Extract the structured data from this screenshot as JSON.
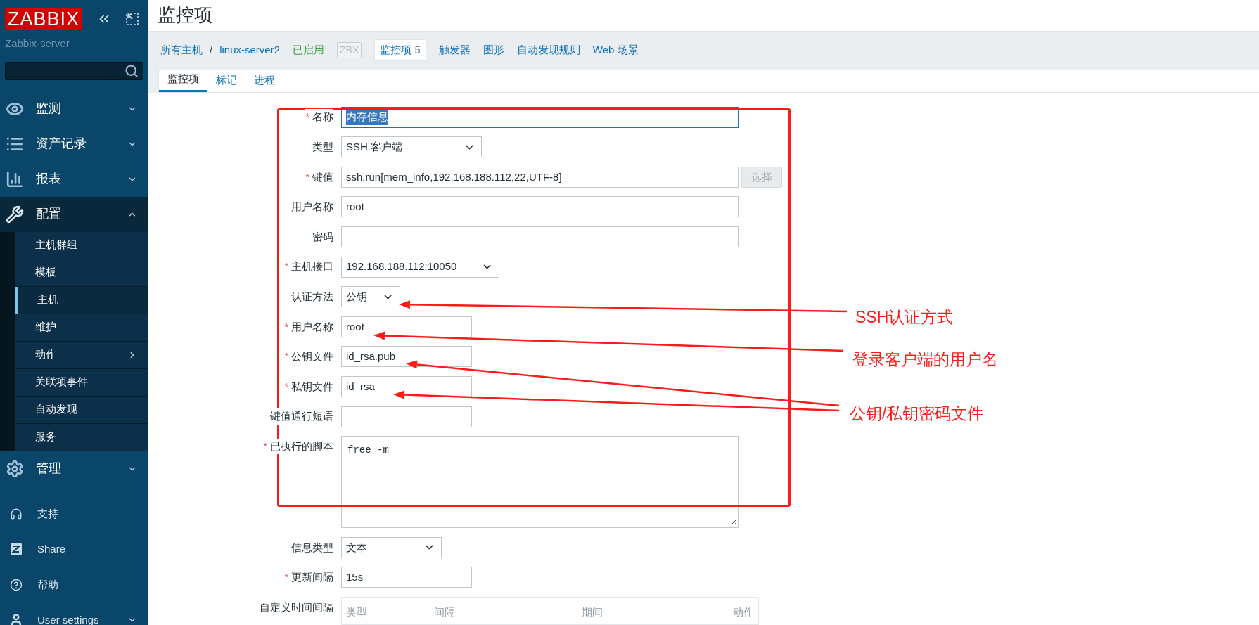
{
  "sidebar": {
    "logo": "ZABBIX",
    "server": "Zabbix-server",
    "menu": [
      {
        "label": "监测",
        "expanded": false
      },
      {
        "label": "资产记录",
        "expanded": false
      },
      {
        "label": "报表",
        "expanded": false
      },
      {
        "label": "配置",
        "expanded": true,
        "children": [
          {
            "label": "主机群组",
            "selected": false,
            "submenu": false
          },
          {
            "label": "模板",
            "selected": false,
            "submenu": false
          },
          {
            "label": "主机",
            "selected": true,
            "submenu": false
          },
          {
            "label": "维护",
            "selected": false,
            "submenu": false
          },
          {
            "label": "动作",
            "selected": false,
            "submenu": true
          },
          {
            "label": "关联项事件",
            "selected": false,
            "submenu": false
          },
          {
            "label": "自动发现",
            "selected": false,
            "submenu": false
          },
          {
            "label": "服务",
            "selected": false,
            "submenu": false
          }
        ]
      },
      {
        "label": "管理",
        "expanded": false
      }
    ],
    "bottom": [
      {
        "label": "支持",
        "expandable": false
      },
      {
        "label": "Share",
        "expandable": false
      },
      {
        "label": "帮助",
        "expandable": false
      },
      {
        "label": "User settings",
        "expandable": true
      }
    ]
  },
  "page_title": "监控项",
  "breadcrumbs": [
    {
      "label": "所有主机",
      "kind": "link"
    },
    {
      "label": "/",
      "kind": "separator"
    },
    {
      "label": "linux-server2",
      "kind": "link"
    },
    {
      "label": "已启用",
      "kind": "status"
    },
    {
      "label": "ZBX",
      "kind": "tag"
    },
    {
      "label": "监控项",
      "count": "5",
      "kind": "current"
    },
    {
      "label": "触发器",
      "kind": "link"
    },
    {
      "label": "图形",
      "kind": "link"
    },
    {
      "label": "自动发现规则",
      "kind": "link"
    },
    {
      "label": "Web 场景",
      "kind": "link"
    }
  ],
  "tabs": [
    {
      "label": "监控项",
      "selected": true
    },
    {
      "label": "标记",
      "selected": false
    },
    {
      "label": "进程",
      "selected": false
    }
  ],
  "required_mark": "*",
  "form": [
    {
      "label": "名称",
      "required": true,
      "kind": "input",
      "value": "内存信息",
      "highlighted": true
    },
    {
      "label": "类型",
      "required": false,
      "kind": "select",
      "value": "SSH 客户端"
    },
    {
      "label": "键值",
      "required": true,
      "kind": "input",
      "value": "ssh.run[mem_info,192.168.188.112,22,UTF-8]",
      "button": {
        "label": "选择",
        "disabled": true
      }
    },
    {
      "label": "用户名称",
      "required": false,
      "kind": "input",
      "value": "root"
    },
    {
      "label": "密码",
      "required": false,
      "kind": "input"
    },
    {
      "label": "主机接口",
      "required": true,
      "kind": "select",
      "value": "192.168.188.112:10050"
    },
    {
      "label": "认证方法",
      "required": false,
      "kind": "select",
      "value": "公钥"
    },
    {
      "label": "用户名称",
      "required": true,
      "kind": "input",
      "value": "root"
    },
    {
      "label": "公钥文件",
      "required": true,
      "kind": "input",
      "value": "id_rsa.pub"
    },
    {
      "label": "私钥文件",
      "required": true,
      "kind": "input",
      "value": "id_rsa"
    },
    {
      "label": "键值通行短语",
      "required": false,
      "kind": "input"
    },
    {
      "label": "已执行的脚本",
      "required": true,
      "kind": "textarea",
      "value": "free -m"
    },
    {
      "label": "信息类型",
      "required": false,
      "kind": "select",
      "value": "文本"
    },
    {
      "label": "更新间隔",
      "required": true,
      "kind": "input",
      "value": "15s"
    },
    {
      "label": "自定义时间间隔",
      "required": false,
      "kind": "table",
      "columns": [
        "类型",
        "间隔",
        "期间",
        "动作"
      ]
    }
  ],
  "annotations": [
    {
      "text": "SSH认证方式"
    },
    {
      "text": "登录客户端的用户名"
    },
    {
      "text": "公钥/私钥密码文件"
    }
  ]
}
